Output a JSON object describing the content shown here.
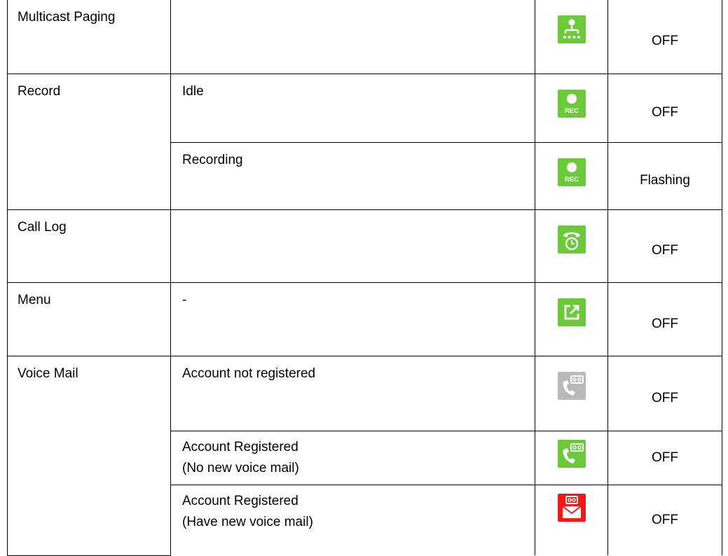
{
  "rows": [
    {
      "name": "Multicast Paging",
      "state": [],
      "icon": "multicast-paging-icon",
      "led": "OFF"
    },
    {
      "name": "Record",
      "state": [
        "Idle"
      ],
      "icon": "record-icon",
      "led": "OFF"
    },
    {
      "state": [
        "Recording"
      ],
      "icon": "record-icon",
      "led": "Flashing"
    },
    {
      "name": "Call Log",
      "state": [],
      "icon": "call-log-icon",
      "led": "OFF"
    },
    {
      "name": "Menu",
      "state": [
        "-"
      ],
      "icon": "menu-icon",
      "led": "OFF"
    },
    {
      "name": "Voice Mail",
      "state": [
        "Account not registered"
      ],
      "icon": "voicemail-icon",
      "led": "OFF"
    },
    {
      "state": [
        "Account Registered",
        "(No new voice mail)"
      ],
      "icon": "voicemail-icon",
      "led": "OFF"
    },
    {
      "state": [
        "Account Registered",
        "(Have new voice mail)"
      ],
      "icon": "new-voicemail-icon",
      "led": "OFF"
    }
  ],
  "colors": {
    "green": "#6cc93a",
    "gray": "#b9b9b9",
    "red": "#f01818",
    "border": "#000000"
  }
}
